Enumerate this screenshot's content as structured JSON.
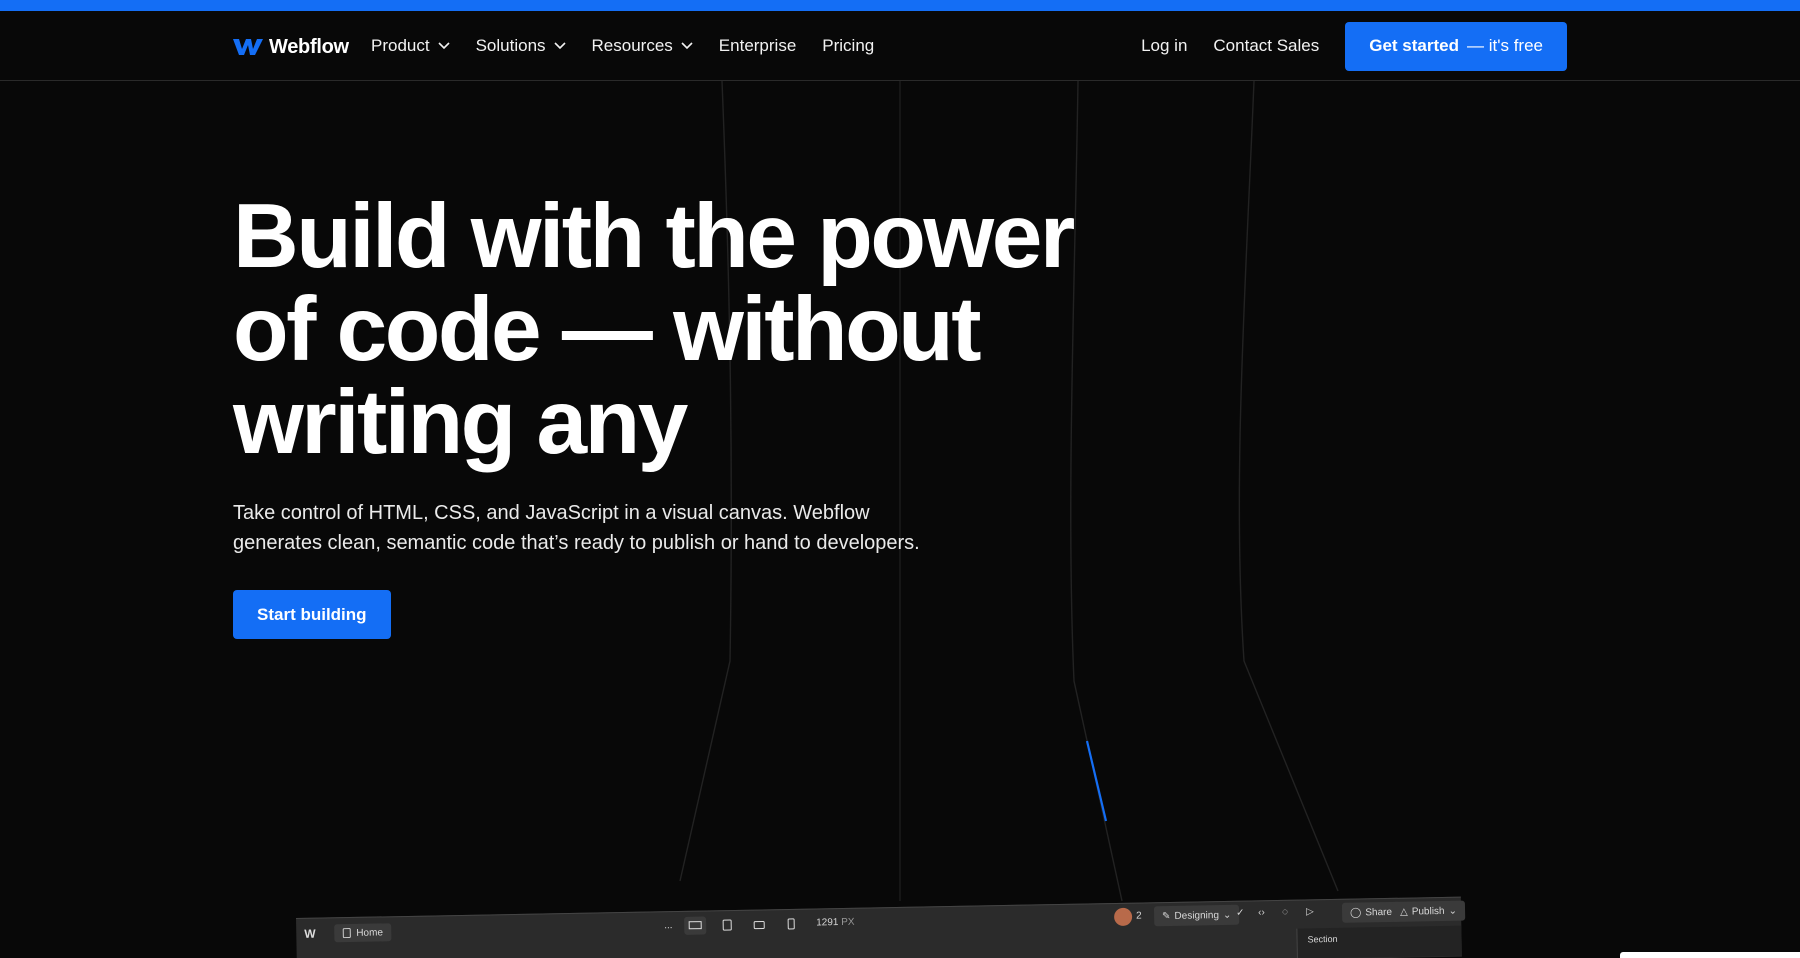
{
  "nav": {
    "brand": "Webflow",
    "items": [
      {
        "label": "Product",
        "dropdown": true
      },
      {
        "label": "Solutions",
        "dropdown": true
      },
      {
        "label": "Resources",
        "dropdown": true
      },
      {
        "label": "Enterprise",
        "dropdown": false
      },
      {
        "label": "Pricing",
        "dropdown": false
      }
    ],
    "login": "Log in",
    "contact": "Contact Sales",
    "cta_main": "Get started",
    "cta_sub": "— it's free"
  },
  "hero": {
    "title_lines": [
      "Build with the power",
      "of code — without",
      "writing any"
    ],
    "subtitle_line1": "Take control of HTML, CSS, and JavaScript in a visual canvas. Webflow",
    "subtitle_line2": "generates clean, semantic code that’s ready to publish or hand to developers.",
    "button": "Start building"
  },
  "designer": {
    "page": "Home",
    "dots": "...",
    "width_value": "1291",
    "width_unit": "PX",
    "collaborators": "2",
    "mode": "Designing",
    "share": "Share",
    "publish": "Publish",
    "panel_label": "Section"
  },
  "colors": {
    "brand_blue": "#146ef5",
    "background": "#080808"
  },
  "icons": [
    "webflow-logo-icon",
    "chevron-down-icon",
    "page-icon",
    "desktop-icon",
    "tablet-icon",
    "mobile-landscape-icon",
    "mobile-icon",
    "pen-icon",
    "check-icon",
    "code-icon",
    "comment-icon",
    "play-icon",
    "share-icon",
    "publish-icon"
  ]
}
